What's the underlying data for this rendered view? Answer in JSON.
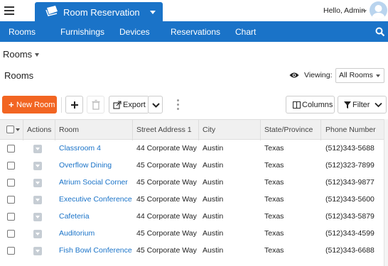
{
  "app": {
    "title": "Room Reservation",
    "user_greeting": "Hello, Admin"
  },
  "nav": {
    "items": [
      "Rooms",
      "Furnishings",
      "Devices",
      "Reservations",
      "Chart"
    ]
  },
  "page": {
    "title": "Rooms",
    "section_title": "Rooms",
    "viewing_label": "Viewing:",
    "viewing_value": "All Rooms"
  },
  "toolbar": {
    "new_label": "New Room",
    "export_label": "Export",
    "columns_label": "Columns",
    "filter_label": "Filter"
  },
  "table": {
    "headers": [
      "Actions",
      "Room",
      "Street Address 1",
      "City",
      "State/Province",
      "Phone Number"
    ],
    "rows": [
      {
        "room": "Classroom 4",
        "address": "44 Corporate Way",
        "city": "Austin",
        "state": "Texas",
        "phone": "(512)343-5688"
      },
      {
        "room": "Overflow Dining",
        "address": "45 Corporate Way",
        "city": "Austin",
        "state": "Texas",
        "phone": "(512)323-7899"
      },
      {
        "room": "Atrium Social Corner",
        "address": "45 Corporate Way",
        "city": "Austin",
        "state": "Texas",
        "phone": "(512)343-9877"
      },
      {
        "room": "Executive Conference",
        "address": "45 Corporate Way",
        "city": "Austin",
        "state": "Texas",
        "phone": "(512)343-5600"
      },
      {
        "room": "Cafeteria",
        "address": "44 Corporate Way",
        "city": "Austin",
        "state": "Texas",
        "phone": "(512)343-5879"
      },
      {
        "room": "Auditorium",
        "address": "45 Corporate Way",
        "city": "Austin",
        "state": "Texas",
        "phone": "(512)343-4599"
      },
      {
        "room": "Fish Bowl Conference",
        "address": "45 Corporate Way",
        "city": "Austin",
        "state": "Texas",
        "phone": "(512)343-6688"
      }
    ]
  },
  "colors": {
    "brand_blue": "#1a73c8",
    "new_button": "#f26522"
  },
  "icons": [
    "menu-icon",
    "app-logo-icon",
    "avatar-icon",
    "search-icon",
    "eye-icon",
    "plus-icon",
    "trash-icon",
    "export-icon",
    "chevron-down-icon",
    "kebab-icon",
    "columns-icon",
    "filter-icon",
    "row-actions-icon"
  ]
}
